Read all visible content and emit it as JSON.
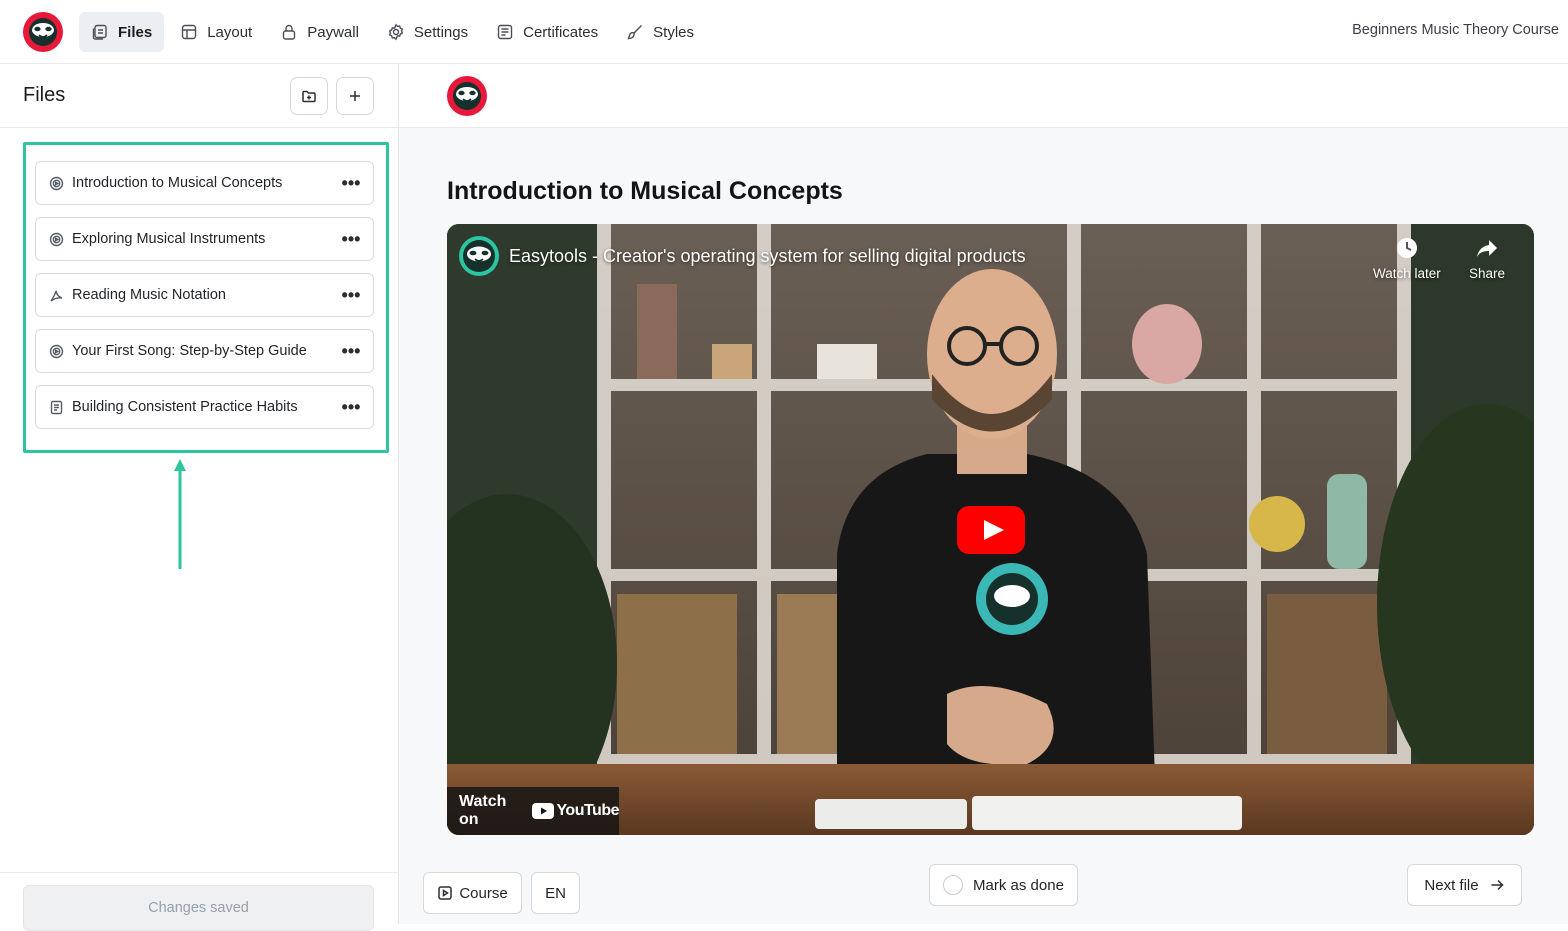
{
  "nav": {
    "items": [
      {
        "label": "Files",
        "icon": "files-icon",
        "active": true
      },
      {
        "label": "Layout",
        "icon": "layout-icon"
      },
      {
        "label": "Paywall",
        "icon": "lock-icon"
      },
      {
        "label": "Settings",
        "icon": "gear-icon"
      },
      {
        "label": "Certificates",
        "icon": "certificate-icon"
      },
      {
        "label": "Styles",
        "icon": "brush-icon"
      }
    ],
    "course_title": "Beginners Music Theory Course"
  },
  "sidebar": {
    "title": "Files",
    "files": [
      {
        "label": "Introduction to Musical Concepts",
        "icon": "video-icon"
      },
      {
        "label": "Exploring Musical Instruments",
        "icon": "video-icon"
      },
      {
        "label": "Reading Music Notation",
        "icon": "pdf-icon"
      },
      {
        "label": "Your First Song: Step-by-Step Guide",
        "icon": "video-icon"
      },
      {
        "label": "Building Consistent Practice Habits",
        "icon": "document-icon"
      }
    ],
    "status": "Changes saved"
  },
  "main": {
    "lesson_title": "Introduction to Musical Concepts",
    "video": {
      "title": "Easytools - Creator's operating system for selling digital products",
      "watch_later": "Watch later",
      "share": "Share",
      "watch_on": "Watch on",
      "youtube": "YouTube"
    },
    "buttons": {
      "course": "Course",
      "language": "EN",
      "mark_done": "Mark as done",
      "next": "Next file"
    }
  },
  "colors": {
    "accent": "#2bc5a0",
    "brand_red": "#e8183a",
    "youtube_red": "#ff0000"
  }
}
